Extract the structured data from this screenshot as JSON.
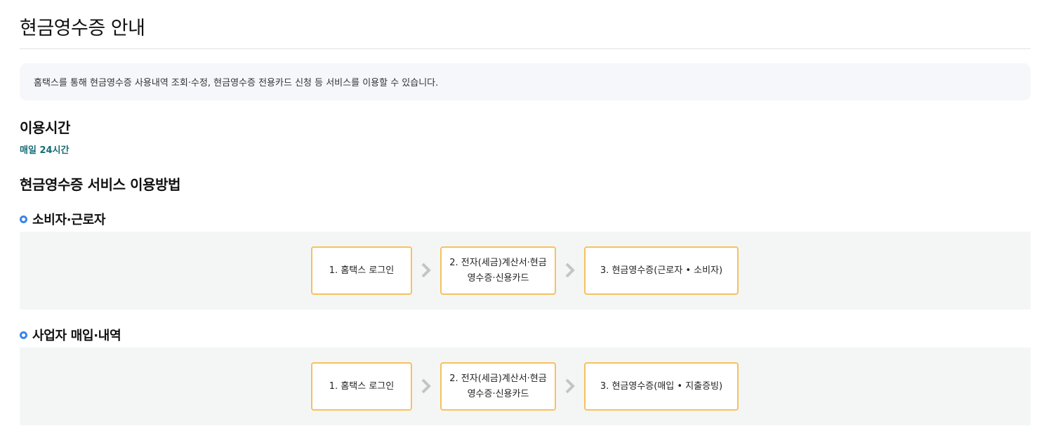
{
  "page": {
    "title": "현금영수증 안내",
    "notice": "홈택스를 통해 현금영수증 사용내역 조회·수정, 현금영수증 전용카드 신청 등 서비스를 이용할 수 있습니다."
  },
  "usage_time": {
    "heading": "이용시간",
    "value": "매일 24시간"
  },
  "howto": {
    "heading": "현금영수증 서비스 이용방법",
    "sections": [
      {
        "title": "소비자·근로자",
        "steps": [
          "1. 홈택스 로그인",
          "2. 전자(세금)계산서·현금영수증·신용카드",
          "3. 현금영수증(근로자 • 소비자)"
        ]
      },
      {
        "title": "사업자 매입·내역",
        "steps": [
          "1. 홈택스 로그인",
          "2. 전자(세금)계산서·현금영수증·신용카드",
          "3. 현금영수증(매입 • 지출증빙)"
        ]
      }
    ]
  },
  "colors": {
    "accent_teal": "#176b74",
    "bullet_blue": "#3a86e8",
    "step_border": "#f6c15e",
    "flow_bg": "#f4f6f6",
    "notice_bg": "#f5f7fb"
  },
  "icons": {
    "bullet": "circle-bullet-icon",
    "arrow": "chevron-right-icon"
  }
}
